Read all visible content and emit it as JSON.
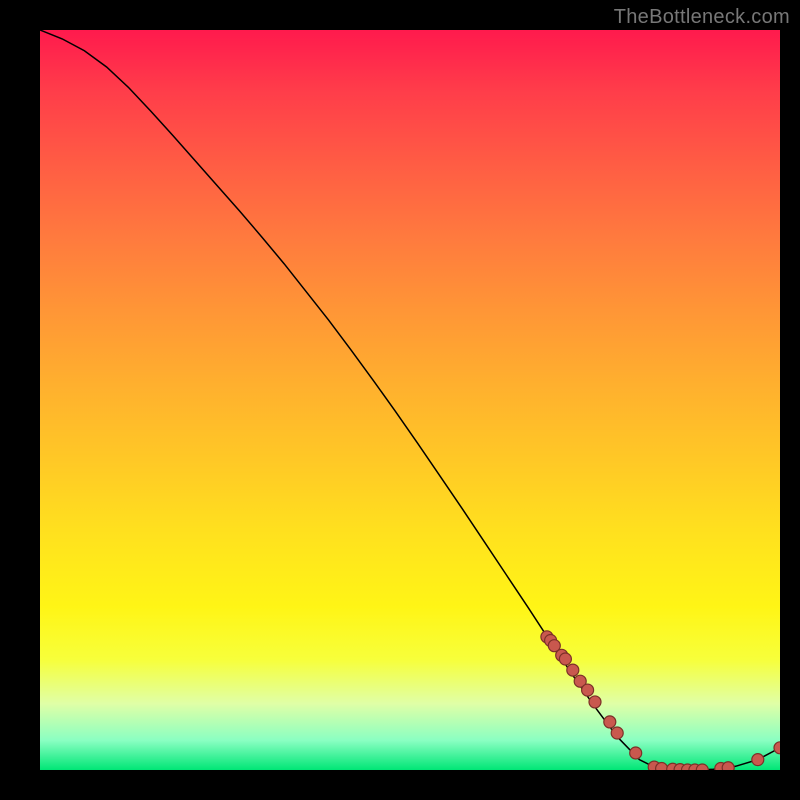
{
  "watermark": "TheBottleneck.com",
  "chart_data": {
    "type": "line",
    "title": "",
    "xlabel": "",
    "ylabel": "",
    "xlim": [
      0,
      100
    ],
    "ylim": [
      0,
      100
    ],
    "grid": false,
    "curve_x": [
      0,
      3,
      6,
      9,
      12,
      15,
      18,
      21,
      24,
      27,
      30,
      33,
      36,
      39,
      42,
      45,
      48,
      51,
      54,
      57,
      60,
      63,
      66,
      69,
      72,
      75,
      78,
      81,
      83,
      85,
      87,
      89,
      91,
      94,
      97,
      100
    ],
    "curve_y": [
      100.0,
      98.8,
      97.2,
      95.0,
      92.2,
      89.0,
      85.7,
      82.3,
      78.9,
      75.5,
      72.0,
      68.4,
      64.6,
      60.8,
      56.8,
      52.7,
      48.5,
      44.2,
      39.8,
      35.4,
      30.9,
      26.4,
      21.9,
      17.3,
      12.8,
      8.5,
      4.5,
      1.4,
      0.4,
      0.1,
      0.0,
      0.0,
      0.1,
      0.5,
      1.4,
      3.0
    ],
    "points_x": [
      68.5,
      69.0,
      69.5,
      70.5,
      71.0,
      72.0,
      73.0,
      74.0,
      75.0,
      77.0,
      78.0,
      80.5,
      83.0,
      84.0,
      85.5,
      86.5,
      87.5,
      88.5,
      89.5,
      92.0,
      93.0,
      97.0,
      100.0
    ],
    "points_y": [
      18.0,
      17.5,
      16.8,
      15.5,
      15.0,
      13.5,
      12.0,
      10.8,
      9.2,
      6.5,
      5.0,
      2.3,
      0.4,
      0.2,
      0.1,
      0.05,
      0.0,
      0.0,
      0.0,
      0.2,
      0.3,
      1.4,
      3.0
    ]
  }
}
